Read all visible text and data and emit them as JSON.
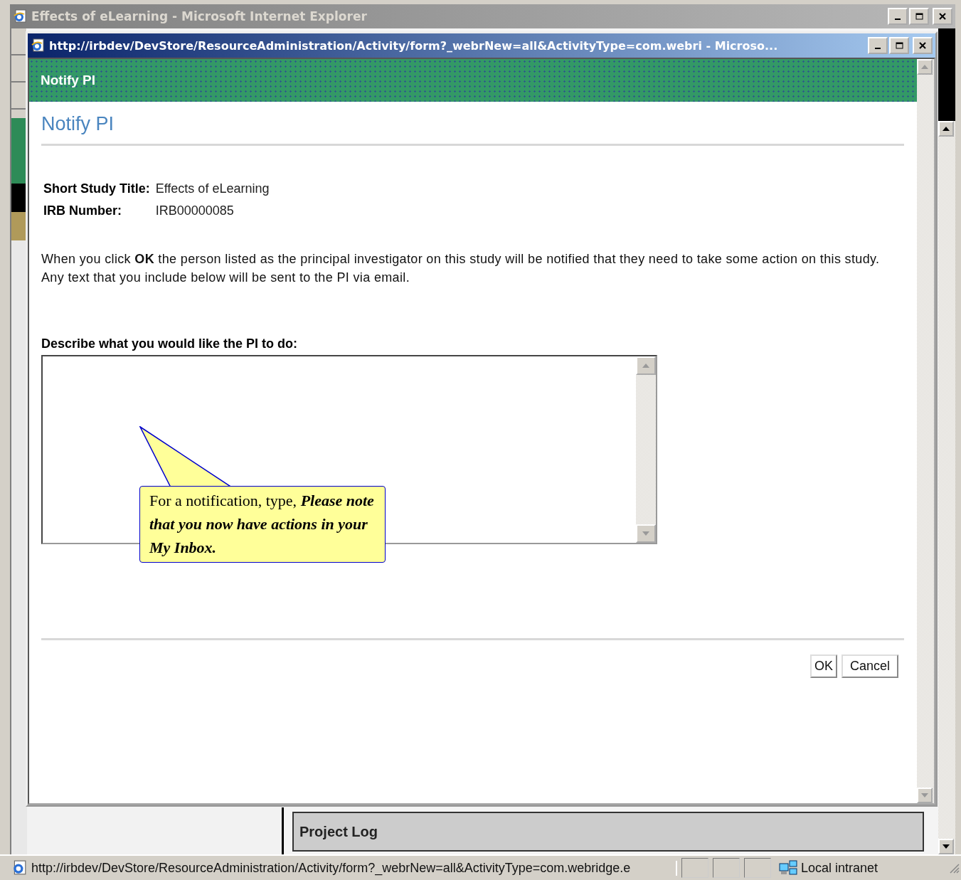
{
  "window": {
    "title": "Effects of eLearning - Microsoft Internet Explorer"
  },
  "popup": {
    "title": "http://irbdev/DevStore/ResourceAdministration/Activity/form?_webrNew=all&ActivityType=com.webri - Microso...",
    "header": "Notify PI",
    "heading": "Notify PI",
    "fields": [
      {
        "label": "Short Study Title:",
        "value": "Effects of eLearning"
      },
      {
        "label": "IRB Number:",
        "value": "IRB00000085"
      }
    ],
    "instructions": "When you click **OK** the person listed as the principal investigator on this study will be notified that they need to take some action on this study. Any text that you include below will be sent to the PI via email.",
    "description": {
      "label": "Describe what you would like the PI to do:"
    },
    "callout": "For a notification, type, **Please note that you now have actions in your My Inbox.**",
    "buttons": [
      "OK",
      "Cancel"
    ]
  },
  "page": {
    "panel_title": "Project Log"
  },
  "status_bar": {
    "url": "http://irbdev/DevStore/ResourceAdministration/Activity/form?_webrNew=all&ActivityType=com.webridge.e",
    "zone": "Local intranet"
  }
}
